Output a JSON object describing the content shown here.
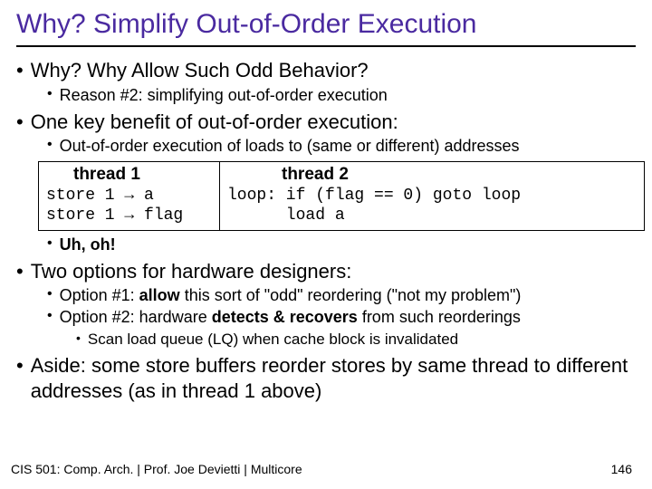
{
  "title": "Why? Simplify Out-of-Order Execution",
  "b1": "Why?  Why Allow Such Odd Behavior?",
  "b1a": "Reason #2: simplifying out-of-order execution",
  "b2": "One key benefit of out-of-order execution:",
  "b2a": "Out-of-order execution of loads to (same or different) addresses",
  "code": {
    "h1": "thread 1",
    "h2": "thread 2",
    "c1l1": "store 1 → a",
    "c1l2": "store 1 → flag",
    "c2l1": "loop: if (flag == 0) goto loop",
    "c2l2": "      load a"
  },
  "b2b": "Uh, oh!",
  "b3": "Two options for hardware designers:",
  "b3a_pre": "Option #1: ",
  "b3a_bold": "allow",
  "b3a_post": " this sort of \"odd\" reordering (\"not my problem\")",
  "b3b_pre": "Option #2: hardware ",
  "b3b_bold": "detects & recovers",
  "b3b_post": " from such reorderings",
  "b3b1": "Scan load queue (LQ) when cache block is invalidated",
  "b4": "Aside: some store buffers reorder stores by same thread to different addresses (as in thread 1 above)",
  "footer_left": "CIS 501: Comp. Arch.  |  Prof. Joe Devietti  |  Multicore",
  "footer_right": "146"
}
